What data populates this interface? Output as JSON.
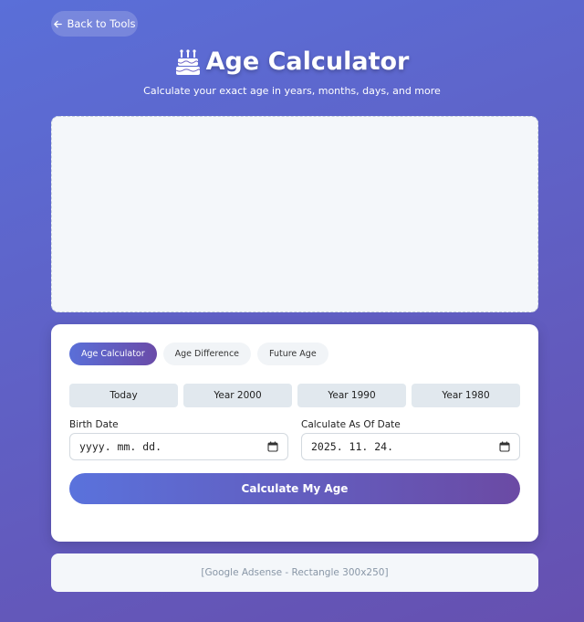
{
  "nav": {
    "back_label": "Back to Tools"
  },
  "header": {
    "title": "Age Calculator",
    "subtitle": "Calculate your exact age in years, months, days, and more"
  },
  "tabs": [
    {
      "label": "Age Calculator",
      "active": true
    },
    {
      "label": "Age Difference",
      "active": false
    },
    {
      "label": "Future Age",
      "active": false
    }
  ],
  "quick_select": [
    {
      "label": "Today"
    },
    {
      "label": "Year 2000"
    },
    {
      "label": "Year 1990"
    },
    {
      "label": "Year 1980"
    }
  ],
  "form": {
    "birth_date_label": "Birth Date",
    "birth_date_value": "yyyy. mm. dd.",
    "as_of_label": "Calculate As Of Date",
    "as_of_value": "2025. 11. 24.",
    "submit_label": "Calculate My Age"
  },
  "ads": {
    "bottom_label": "[Google Adsense - Rectangle 300x250]"
  },
  "colors": {
    "background_start": "#5a6fd8",
    "background_end": "#6650b0",
    "accent_start": "#5a72dc",
    "accent_end": "#6b4aa4"
  },
  "icons": {
    "back": "arrow-left-icon",
    "title": "birthday-cake-icon",
    "calendar": "calendar-icon"
  }
}
